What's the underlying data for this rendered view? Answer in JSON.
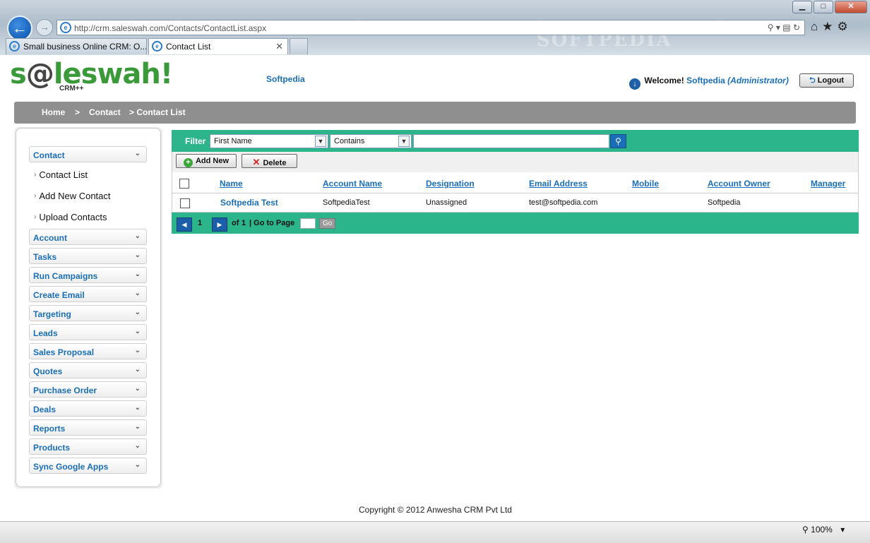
{
  "browser": {
    "address": "http://crm.saleswah.com/Contacts/ContactList.aspx",
    "tabs": [
      {
        "label": "Small business Online CRM: O..."
      },
      {
        "label": "Contact List",
        "close": "✕"
      }
    ],
    "watermark": "SOFTPEDIA",
    "zoom": "100%"
  },
  "header": {
    "brand_prefix": "s",
    "brand_at": "@",
    "brand_suffix": "leswah!",
    "brand_sub": "CRM++",
    "org": "Softpedia",
    "welcome": "Welcome!",
    "user": "Softpedia",
    "role": "(Administrator)",
    "logout": "Logout"
  },
  "breadcrumb": {
    "home": "Home",
    "sep": ">",
    "contact": "Contact",
    "current": "> Contact List"
  },
  "sidebar": {
    "contact": "Contact",
    "contact_sub": [
      "Contact List",
      "Add New Contact",
      "Upload Contacts"
    ],
    "items": [
      "Account",
      "Tasks",
      "Run Campaigns",
      "Create Email",
      "Targeting",
      "Leads",
      "Sales Proposal",
      "Quotes",
      "Purchase Order",
      "Deals",
      "Reports",
      "Products",
      "Sync Google Apps"
    ]
  },
  "filter": {
    "label": "Filter",
    "field": "First Name",
    "operator": "Contains",
    "value": ""
  },
  "toolbar": {
    "add": "Add New",
    "delete": "Delete"
  },
  "grid": {
    "columns": [
      "Name",
      "Account Name",
      "Designation",
      "Email Address",
      "Mobile",
      "Account Owner",
      "Manager"
    ],
    "rows": [
      {
        "name": "Softpedia Test",
        "account": "SoftpediaTest",
        "designation": "Unassigned",
        "email": "test@softpedia.com",
        "mobile": "",
        "owner": "Softpedia",
        "manager": ""
      }
    ]
  },
  "pager": {
    "page": "1",
    "of": "of",
    "total": "1",
    "goto": "| Go to Page",
    "go": "Go"
  },
  "footer": {
    "copyright": "Copyright © 2012 Anwesha CRM Pvt Ltd"
  }
}
